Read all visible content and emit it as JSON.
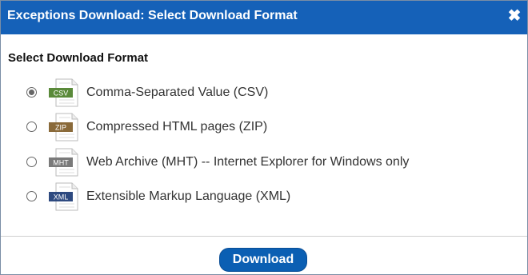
{
  "dialog": {
    "title": "Exceptions Download: Select Download Format",
    "close_icon": "close-icon",
    "section_title": "Select Download Format",
    "options": [
      {
        "badge": "CSV",
        "label": "Comma-Separated Value (CSV)",
        "badge_color": "#5a8a3a",
        "selected": true
      },
      {
        "badge": "ZIP",
        "label": "Compressed HTML pages (ZIP)",
        "badge_color": "#8a6a3a",
        "selected": false
      },
      {
        "badge": "MHT",
        "label": "Web Archive (MHT) -- Internet Explorer for Windows only",
        "badge_color": "#7a7a7a",
        "selected": false
      },
      {
        "badge": "XML",
        "label": "Extensible Markup Language (XML)",
        "badge_color": "#2e4a80",
        "selected": false
      }
    ],
    "download_label": "Download"
  }
}
